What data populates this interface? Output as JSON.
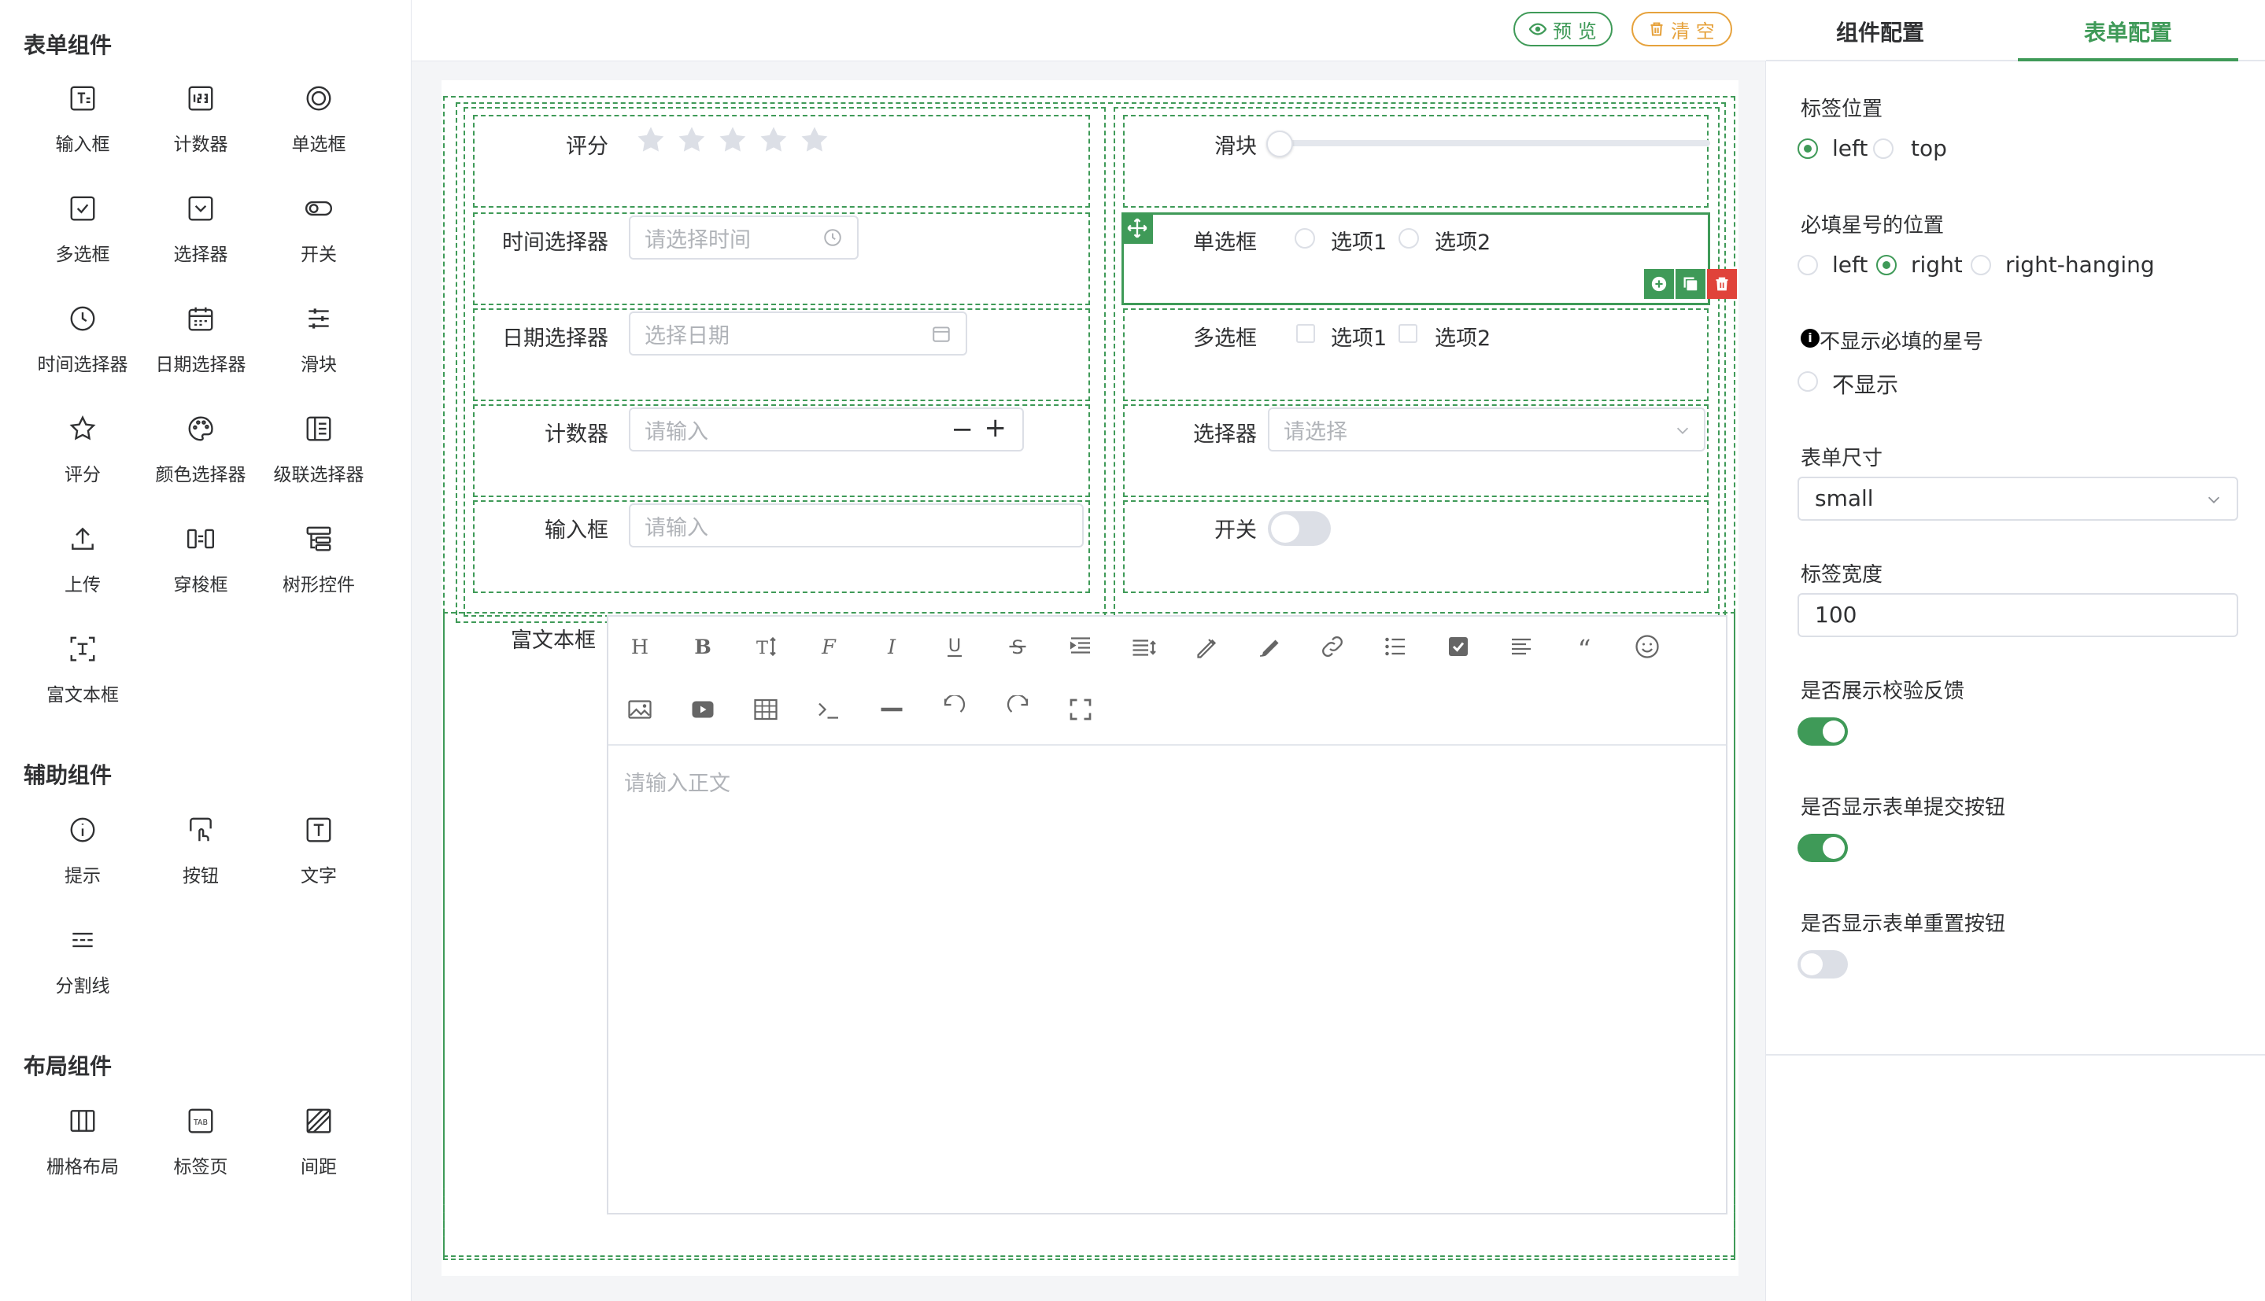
{
  "left": {
    "sections": [
      "表单组件",
      "辅助组件",
      "布局组件"
    ],
    "form_components": [
      "输入框",
      "计数器",
      "单选框",
      "多选框",
      "选择器",
      "开关",
      "时间选择器",
      "日期选择器",
      "滑块",
      "评分",
      "颜色选择器",
      "级联选择器",
      "上传",
      "穿梭框",
      "树形控件",
      "富文本框"
    ],
    "aux_components": [
      "提示",
      "按钮",
      "文字",
      "分割线"
    ],
    "layout_components": [
      "栅格布局",
      "标签页",
      "间距"
    ]
  },
  "topbar": {
    "preview": "预 览",
    "clear": "清 空"
  },
  "form": {
    "rate": {
      "label": "评分",
      "stars": 5,
      "value": 0
    },
    "slider": {
      "label": "滑块",
      "value": 0
    },
    "time": {
      "label": "时间选择器",
      "placeholder": "请选择时间"
    },
    "radio": {
      "label": "单选框",
      "options": [
        "选项1",
        "选项2"
      ]
    },
    "date": {
      "label": "日期选择器",
      "placeholder": "选择日期"
    },
    "checkbox": {
      "label": "多选框",
      "options": [
        "选项1",
        "选项2"
      ]
    },
    "counter": {
      "label": "计数器",
      "placeholder": "请输入",
      "minus": "−",
      "plus": "+"
    },
    "select": {
      "label": "选择器",
      "placeholder": "请选择"
    },
    "input": {
      "label": "输入框",
      "placeholder": "请输入"
    },
    "switch": {
      "label": "开关",
      "on": false
    },
    "richtext": {
      "label": "富文本框",
      "placeholder": "请输入正文"
    }
  },
  "right": {
    "tabs": [
      "组件配置",
      "表单配置"
    ],
    "active_tab": 1,
    "label_position": {
      "title": "标签位置",
      "options": [
        "left",
        "top"
      ],
      "selected": "left"
    },
    "required_pos": {
      "title": "必填星号的位置",
      "options": [
        "left",
        "right",
        "right-hanging"
      ],
      "selected": "right"
    },
    "hide_required": {
      "title": "不显示必填的星号",
      "option": "不显示"
    },
    "size": {
      "title": "表单尺寸",
      "value": "small"
    },
    "label_width": {
      "title": "标签宽度",
      "value": "100"
    },
    "show_feedback": {
      "title": "是否展示校验反馈",
      "on": true
    },
    "show_submit": {
      "title": "是否显示表单提交按钮",
      "on": true
    },
    "show_reset": {
      "title": "是否显示表单重置按钮",
      "on": false
    }
  },
  "colors": {
    "accent": "#3f9a58",
    "danger": "#e0433a",
    "warn": "#e6a23c"
  }
}
